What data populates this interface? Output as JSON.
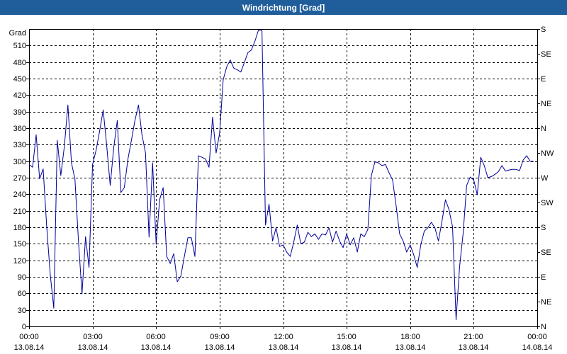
{
  "colors": {
    "title_bar": "#1f5d9b",
    "title_text": "#ffffff",
    "series_line": "#00009c",
    "grid": "#000000"
  },
  "chart_data": {
    "type": "line",
    "title": "Windrichtung [Grad]",
    "xlabel": "",
    "ylabel": "Grad",
    "ylim": [
      0,
      540
    ],
    "xlim": [
      "13.08.14 00:00",
      "14.08.14 00:00"
    ],
    "grid": true,
    "legend": "none",
    "yticks": [
      0,
      30,
      60,
      90,
      120,
      150,
      180,
      210,
      240,
      270,
      300,
      330,
      360,
      390,
      420,
      450,
      480,
      510
    ],
    "y2ticks": [
      {
        "value": 540,
        "label": "S"
      },
      {
        "value": 495,
        "label": "SE"
      },
      {
        "value": 450,
        "label": "E"
      },
      {
        "value": 405,
        "label": "NE"
      },
      {
        "value": 360,
        "label": "N"
      },
      {
        "value": 315,
        "label": "NW"
      },
      {
        "value": 270,
        "label": "W"
      },
      {
        "value": 225,
        "label": "SW"
      },
      {
        "value": 180,
        "label": "S"
      },
      {
        "value": 135,
        "label": "SE"
      },
      {
        "value": 90,
        "label": "E"
      },
      {
        "value": 45,
        "label": "NE"
      },
      {
        "value": 0,
        "label": "N"
      }
    ],
    "xticks": [
      {
        "time": "00:00",
        "date": "13.08.14"
      },
      {
        "time": "03:00",
        "date": "13.08.14"
      },
      {
        "time": "06:00",
        "date": "13.08.14"
      },
      {
        "time": "09:00",
        "date": "13.08.14"
      },
      {
        "time": "12:00",
        "date": "13.08.14"
      },
      {
        "time": "15:00",
        "date": "13.08.14"
      },
      {
        "time": "18:00",
        "date": "13.08.14"
      },
      {
        "time": "21:00",
        "date": "13.08.14"
      },
      {
        "time": "00:00",
        "date": "14.08.14"
      }
    ],
    "series": [
      {
        "x": [
          "13.08.14 00:00",
          "13.08.14 00:10",
          "13.08.14 00:20",
          "13.08.14 00:30",
          "13.08.14 00:40",
          "13.08.14 00:50",
          "13.08.14 01:00",
          "13.08.14 01:10",
          "13.08.14 01:20",
          "13.08.14 01:30",
          "13.08.14 01:40",
          "13.08.14 01:50",
          "13.08.14 02:00",
          "13.08.14 02:10",
          "13.08.14 02:20",
          "13.08.14 02:30",
          "13.08.14 02:40",
          "13.08.14 02:50",
          "13.08.14 03:00",
          "13.08.14 03:10",
          "13.08.14 03:20",
          "13.08.14 03:30",
          "13.08.14 03:40",
          "13.08.14 03:50",
          "13.08.14 04:00",
          "13.08.14 04:10",
          "13.08.14 04:20",
          "13.08.14 04:30",
          "13.08.14 04:40",
          "13.08.14 04:50",
          "13.08.14 05:00",
          "13.08.14 05:10",
          "13.08.14 05:20",
          "13.08.14 05:30",
          "13.08.14 05:40",
          "13.08.14 05:50",
          "13.08.14 06:00",
          "13.08.14 06:10",
          "13.08.14 06:20",
          "13.08.14 06:30",
          "13.08.14 06:40",
          "13.08.14 06:50",
          "13.08.14 07:00",
          "13.08.14 07:10",
          "13.08.14 07:20",
          "13.08.14 07:30",
          "13.08.14 07:40",
          "13.08.14 07:50",
          "13.08.14 08:00",
          "13.08.14 08:10",
          "13.08.14 08:20",
          "13.08.14 08:30",
          "13.08.14 08:40",
          "13.08.14 08:50",
          "13.08.14 09:00",
          "13.08.14 09:10",
          "13.08.14 09:20",
          "13.08.14 09:30",
          "13.08.14 09:40",
          "13.08.14 09:50",
          "13.08.14 10:00",
          "13.08.14 10:10",
          "13.08.14 10:20",
          "13.08.14 10:30",
          "13.08.14 10:40",
          "13.08.14 10:50",
          "13.08.14 11:00",
          "13.08.14 11:10",
          "13.08.14 11:20",
          "13.08.14 11:30",
          "13.08.14 11:40",
          "13.08.14 11:50",
          "13.08.14 12:00",
          "13.08.14 12:10",
          "13.08.14 12:20",
          "13.08.14 12:30",
          "13.08.14 12:40",
          "13.08.14 12:50",
          "13.08.14 13:00",
          "13.08.14 13:10",
          "13.08.14 13:20",
          "13.08.14 13:30",
          "13.08.14 13:40",
          "13.08.14 13:50",
          "13.08.14 14:00",
          "13.08.14 14:10",
          "13.08.14 14:20",
          "13.08.14 14:30",
          "13.08.14 14:40",
          "13.08.14 14:50",
          "13.08.14 15:00",
          "13.08.14 15:10",
          "13.08.14 15:20",
          "13.08.14 15:30",
          "13.08.14 15:40",
          "13.08.14 15:50",
          "13.08.14 16:00",
          "13.08.14 16:10",
          "13.08.14 16:20",
          "13.08.14 16:30",
          "13.08.14 16:40",
          "13.08.14 16:50",
          "13.08.14 17:00",
          "13.08.14 17:10",
          "13.08.14 17:20",
          "13.08.14 17:30",
          "13.08.14 17:40",
          "13.08.14 17:50",
          "13.08.14 18:00",
          "13.08.14 18:10",
          "13.08.14 18:20",
          "13.08.14 18:30",
          "13.08.14 18:40",
          "13.08.14 18:50",
          "13.08.14 19:00",
          "13.08.14 19:10",
          "13.08.14 19:20",
          "13.08.14 19:30",
          "13.08.14 19:40",
          "13.08.14 19:50",
          "13.08.14 20:00",
          "13.08.14 20:10",
          "13.08.14 20:20",
          "13.08.14 20:30",
          "13.08.14 20:40",
          "13.08.14 20:50",
          "13.08.14 21:00",
          "13.08.14 21:10",
          "13.08.14 21:20",
          "13.08.14 21:30",
          "13.08.14 21:40",
          "13.08.14 21:50",
          "13.08.14 22:00",
          "13.08.14 22:10",
          "13.08.14 22:20",
          "13.08.14 22:30",
          "13.08.14 22:40",
          "13.08.14 22:50",
          "13.08.14 23:00",
          "13.08.14 23:10",
          "13.08.14 23:20",
          "13.08.14 23:30",
          "13.08.14 23:40",
          "13.08.14 23:50"
        ],
        "y": [
          294,
          289,
          348,
          268,
          286,
          181,
          94,
          33,
          338,
          274,
          327,
          402,
          297,
          268,
          155,
          59,
          163,
          107,
          294,
          320,
          355,
          393,
          329,
          256,
          325,
          374,
          243,
          252,
          303,
          338,
          374,
          402,
          348,
          315,
          162,
          297,
          149,
          230,
          252,
          127,
          114,
          132,
          81,
          91,
          127,
          161,
          161,
          127,
          310,
          307,
          304,
          289,
          380,
          315,
          351,
          448,
          471,
          484,
          469,
          466,
          462,
          479,
          497,
          502,
          518,
          538,
          538,
          184,
          222,
          155,
          179,
          145,
          148,
          135,
          127,
          153,
          184,
          150,
          153,
          171,
          163,
          168,
          158,
          168,
          166,
          179,
          153,
          173,
          155,
          143,
          168,
          148,
          161,
          135,
          168,
          163,
          176,
          274,
          299,
          297,
          292,
          294,
          279,
          266,
          220,
          168,
          155,
          135,
          148,
          130,
          107,
          148,
          173,
          179,
          189,
          179,
          155,
          191,
          230,
          212,
          181,
          12,
          109,
          168,
          256,
          271,
          266,
          239,
          307,
          292,
          270,
          272,
          276,
          281,
          292,
          282,
          284,
          285,
          285,
          283,
          302,
          310,
          300,
          300
        ]
      }
    ]
  }
}
